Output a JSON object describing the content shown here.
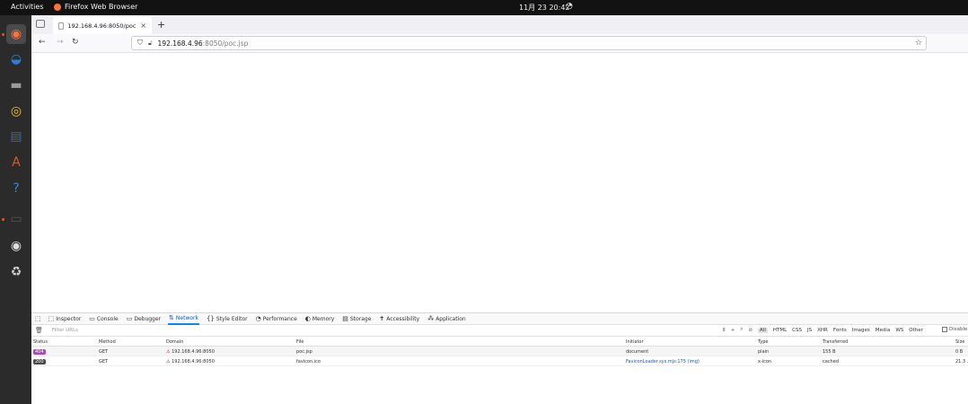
{
  "topbar": {
    "activities": "Activities",
    "app_name": "Firefox Web Browser",
    "clock": "11月 23  20:42"
  },
  "dock": {
    "items": [
      {
        "name": "firefox",
        "color": "#ff7139"
      },
      {
        "name": "thunderbird",
        "color": "#2a7fd4"
      },
      {
        "name": "files",
        "color": "#9a9a9a"
      },
      {
        "name": "rhythmbox",
        "color": "#f4c430"
      },
      {
        "name": "writer",
        "color": "#1e6fd9"
      },
      {
        "name": "software",
        "color": "#e95420"
      },
      {
        "name": "help",
        "color": "#3584e4"
      },
      {
        "name": "terminal",
        "color": "#555555"
      },
      {
        "name": "dvd",
        "color": "#dddddd"
      },
      {
        "name": "trash",
        "color": "#cfcfcf"
      }
    ]
  },
  "browser": {
    "tab_title": "192.168.4.96:8050/poc.jsp",
    "new_tab": "+",
    "url_host": "192.168.4.96",
    "url_path": ":8050/poc.jsp"
  },
  "devtools": {
    "tabs": [
      {
        "label": "Inspector",
        "icon": "inspector-icon",
        "glyph": "⬚"
      },
      {
        "label": "Console",
        "icon": "console-icon",
        "glyph": "▭"
      },
      {
        "label": "Debugger",
        "icon": "debugger-icon",
        "glyph": "▭"
      },
      {
        "label": "Network",
        "icon": "network-icon",
        "glyph": "⇅",
        "active": true
      },
      {
        "label": "Style Editor",
        "icon": "style-editor-icon",
        "glyph": "{}"
      },
      {
        "label": "Performance",
        "icon": "performance-icon",
        "glyph": "◔"
      },
      {
        "label": "Memory",
        "icon": "memory-icon",
        "glyph": "◐"
      },
      {
        "label": "Storage",
        "icon": "storage-icon",
        "glyph": "▤"
      },
      {
        "label": "Accessibility",
        "icon": "accessibility-icon",
        "glyph": "✝"
      },
      {
        "label": "Application",
        "icon": "application-icon",
        "glyph": "⁂"
      }
    ],
    "filter_placeholder": "Filter URLs",
    "filters": [
      "All",
      "HTML",
      "CSS",
      "JS",
      "XHR",
      "Fonts",
      "Images",
      "Media",
      "WS",
      "Other"
    ],
    "disable_cache": "Disable",
    "columns": {
      "status": "Status",
      "method": "Method",
      "domain": "Domain",
      "file": "File",
      "initiator": "Initiator",
      "type": "Type",
      "transferred": "Transferred",
      "size": "Size"
    },
    "rows": [
      {
        "status": "404",
        "status_color": "#a347ba",
        "method": "GET",
        "domain": "192.168.4.96:8050",
        "file": "poc.jsp",
        "initiator": "document",
        "type": "plain",
        "transferred": "155 B",
        "size": "0 B"
      },
      {
        "status": "200",
        "status_color": "#4a4a4a",
        "method": "GET",
        "domain": "192.168.4.96:8050",
        "file": "favicon.ico",
        "initiator": "FaviconLoader.sys.mjs:175 (img)",
        "type": "x-icon",
        "transferred": "cached",
        "size": "21.3 ..."
      }
    ]
  }
}
